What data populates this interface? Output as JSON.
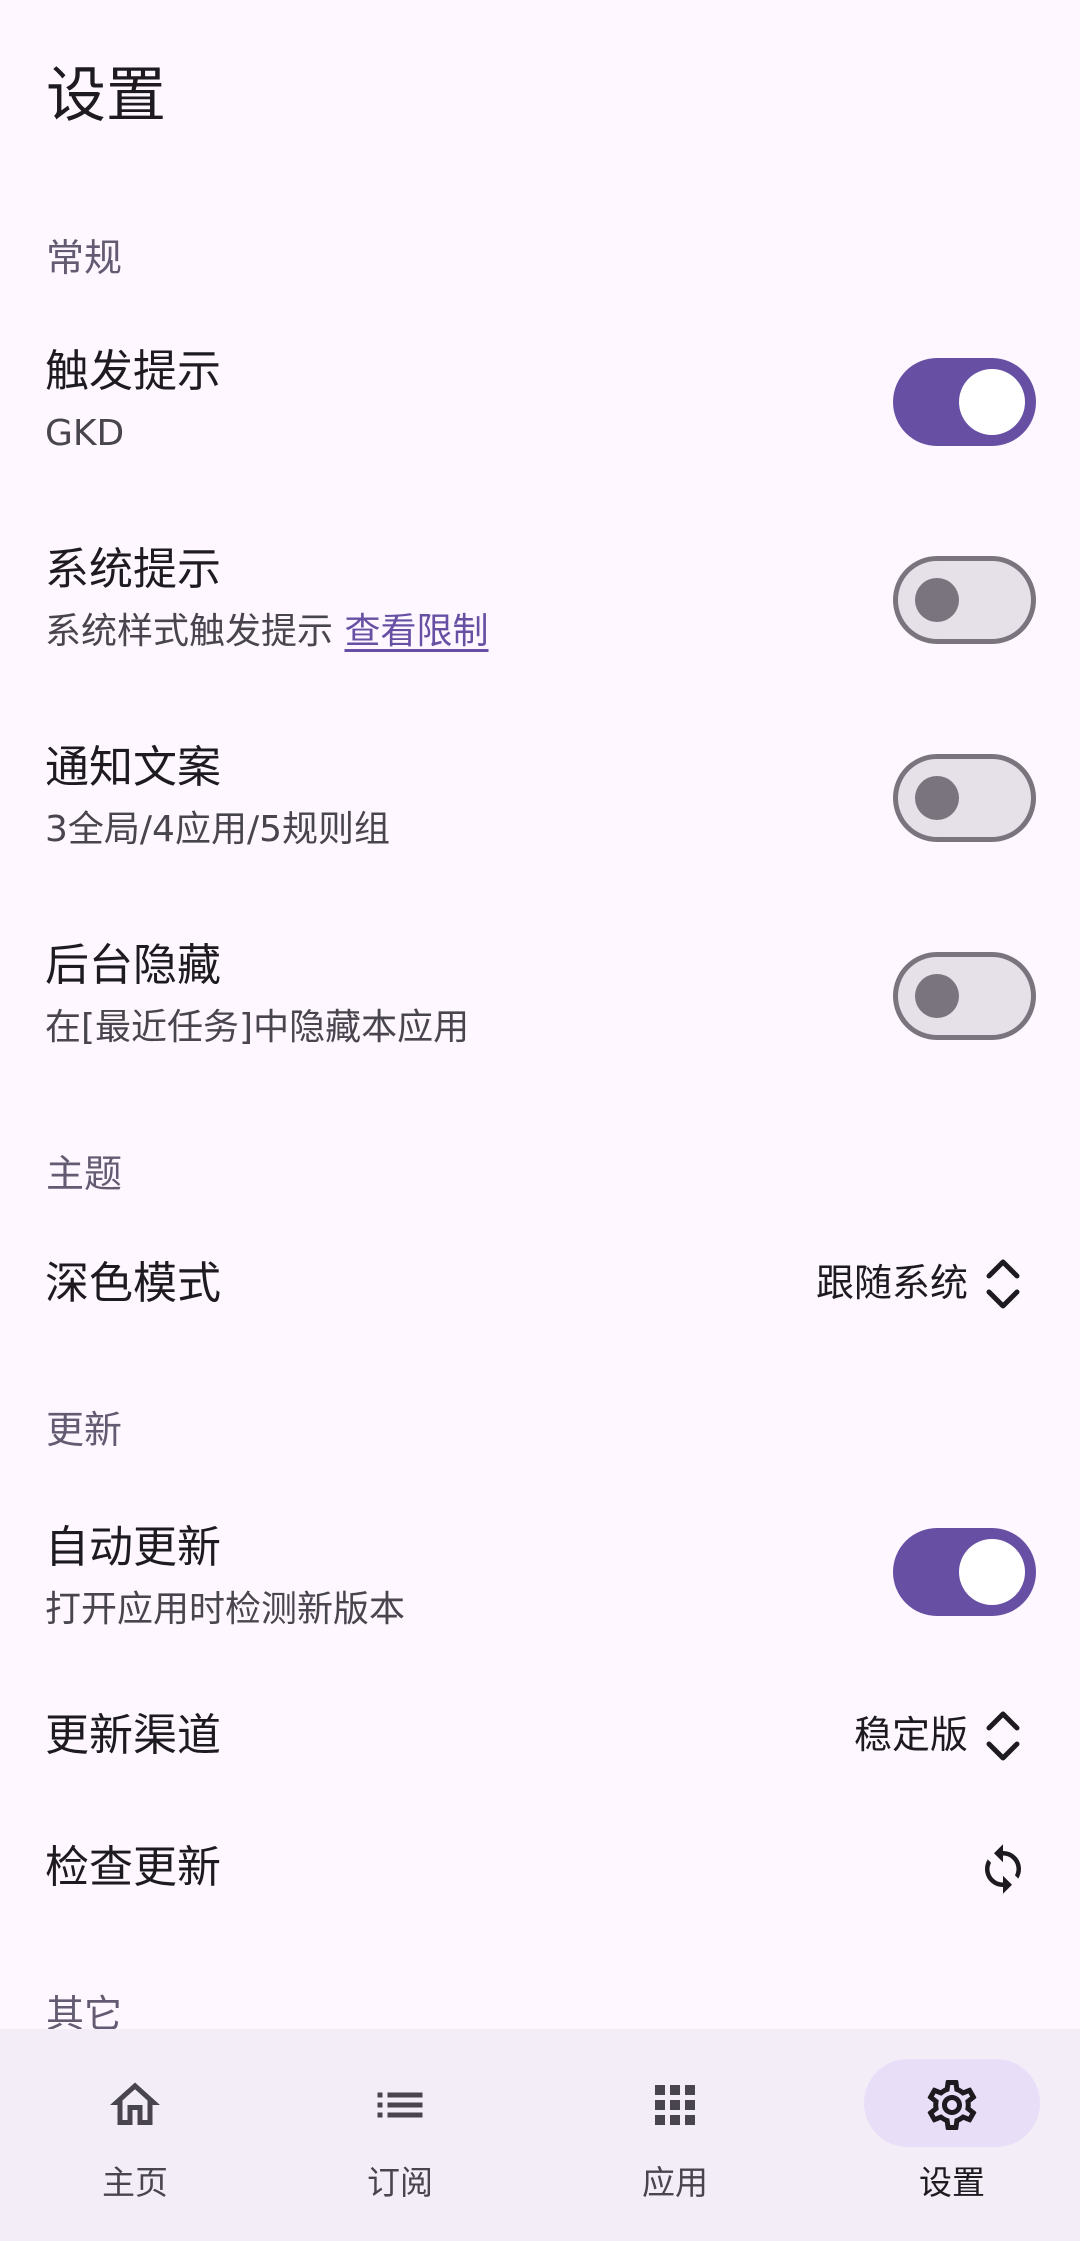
{
  "page": {
    "title": "设置"
  },
  "sections": {
    "general": "常规",
    "theme": "主题",
    "update": "更新",
    "other": "其它"
  },
  "general": {
    "trigger_tip": {
      "title": "触发提示",
      "subtitle": "GKD",
      "enabled": true
    },
    "system_tip": {
      "title": "系统提示",
      "subtitle": "系统样式触发提示",
      "link": "查看限制",
      "enabled": false
    },
    "notify_text": {
      "title": "通知文案",
      "subtitle": "3全局/4应用/5规则组",
      "enabled": false
    },
    "hide_background": {
      "title": "后台隐藏",
      "subtitle": "在[最近任务]中隐藏本应用",
      "enabled": false
    }
  },
  "theme": {
    "dark_mode": {
      "title": "深色模式",
      "value": "跟随系统",
      "icon": "unfold-more-icon"
    }
  },
  "update": {
    "auto_update": {
      "title": "自动更新",
      "subtitle": "打开应用时检测新版本",
      "enabled": true
    },
    "channel": {
      "title": "更新渠道",
      "value": "稳定版",
      "icon": "unfold-more-icon"
    },
    "check": {
      "title": "检查更新",
      "icon": "sync-icon"
    }
  },
  "bottom_nav": [
    {
      "label": "主页",
      "icon": "home-icon",
      "active": false
    },
    {
      "label": "订阅",
      "icon": "list-icon",
      "active": false
    },
    {
      "label": "应用",
      "icon": "apps-grid-icon",
      "active": false
    },
    {
      "label": "设置",
      "icon": "settings-gear-icon",
      "active": true
    }
  ],
  "colors": {
    "background": "#FEF7FF",
    "primary": "#6750A4",
    "section_header": "#625B71",
    "nav_background": "#F3EDF7",
    "nav_indicator": "#E8DEF8",
    "switch_off_track": "#E6E0E9",
    "switch_off_outline": "#79747E"
  }
}
